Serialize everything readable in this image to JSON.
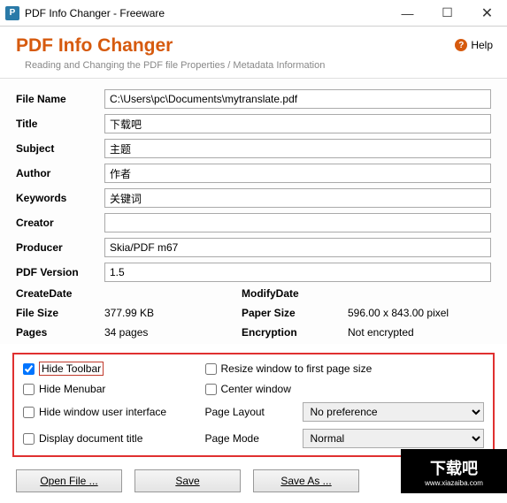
{
  "window": {
    "title": "PDF Info Changer - Freeware"
  },
  "header": {
    "title": "PDF Info Changer",
    "subtitle": "Reading and Changing the PDF file Properties / Metadata Information",
    "help": "Help"
  },
  "fields": {
    "file_name_label": "File Name",
    "file_name": "C:\\Users\\pc\\Documents\\mytranslate.pdf",
    "title_label": "Title",
    "title": "下载吧",
    "subject_label": "Subject",
    "subject": "主题",
    "author_label": "Author",
    "author": "作者",
    "keywords_label": "Keywords",
    "keywords": "关键词",
    "creator_label": "Creator",
    "creator": "",
    "producer_label": "Producer",
    "producer": "Skia/PDF m67",
    "pdf_version_label": "PDF Version",
    "pdf_version": "1.5"
  },
  "info": {
    "create_date_label": "CreateDate",
    "create_date": "",
    "modify_date_label": "ModifyDate",
    "modify_date": "",
    "file_size_label": "File Size",
    "file_size": "377.99 KB",
    "paper_size_label": "Paper Size",
    "paper_size": "596.00 x 843.00 pixel",
    "pages_label": "Pages",
    "pages": "34 pages",
    "encryption_label": "Encryption",
    "encryption": "Not encrypted"
  },
  "options": {
    "hide_toolbar": "Hide Toolbar",
    "hide_menubar": "Hide Menubar",
    "hide_ui": "Hide window user interface",
    "display_title": "Display document title",
    "resize_window": "Resize window to first page size",
    "center_window": "Center window",
    "page_layout_label": "Page Layout",
    "page_layout": "No preference",
    "page_mode_label": "Page Mode",
    "page_mode": "Normal"
  },
  "buttons": {
    "open": "Open File ...",
    "save": "Save",
    "save_as": "Save As ..."
  },
  "watermark": {
    "text": "下载吧",
    "url": "www.xiazaiba.com"
  }
}
